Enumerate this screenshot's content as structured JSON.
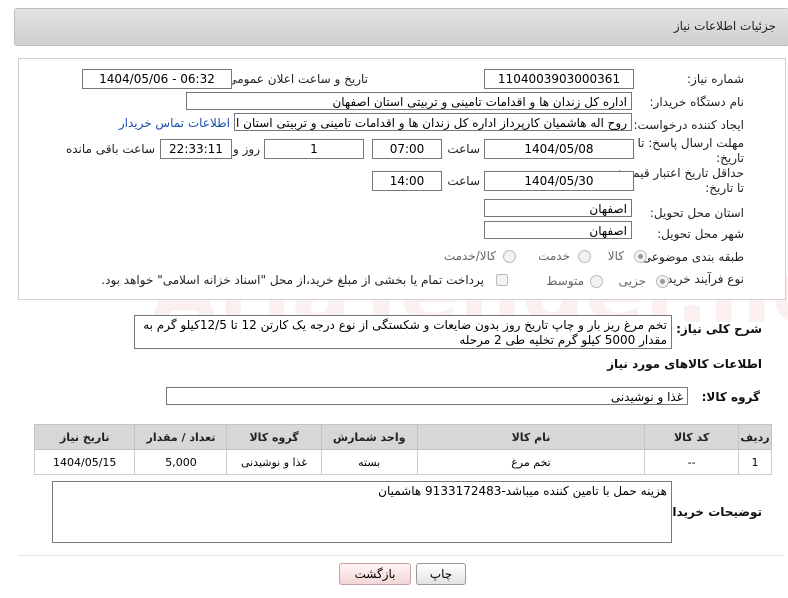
{
  "header": {
    "title": "جزئیات اطلاعات نیاز"
  },
  "form": {
    "need_number_label": "شماره نیاز:",
    "need_number": "1104003903000361",
    "announce_label": "تاریخ و ساعت اعلان عمومی:",
    "announce_value": "1404/05/06 - 06:32",
    "buyer_org_label": "نام دستگاه خریدار:",
    "buyer_org": "اداره کل زندان ها و اقدامات تامینی و تربیتی استان اصفهان",
    "creator_label": "ایجاد کننده درخواست:",
    "creator": "روح اله هاشمیان کارپرداز اداره کل زندان ها و اقدامات تامینی و تربیتی استان اصفهان",
    "contact_link": "اطلاعات تماس خریدار",
    "deadline_label": "مهلت ارسال پاسخ: تا تاریخ:",
    "deadline_date": "1404/05/08",
    "time_label": "ساعت",
    "deadline_time": "07:00",
    "days_value": "1",
    "days_label": "روز و",
    "remaining_time": "22:33:11",
    "remaining_label": "ساعت باقی مانده",
    "price_validity_label": "حداقل تاریخ اعتبار قیمت: تا تاریخ:",
    "price_date": "1404/05/30",
    "price_time": "14:00",
    "province_label": "استان محل تحویل:",
    "province": "اصفهان",
    "city_label": "شهر محل تحویل:",
    "city": "اصفهان",
    "category_label": "طبقه بندی موضوعی:",
    "category_options": [
      "کالا",
      "خدمت",
      "کالا/خدمت"
    ],
    "process_label": "نوع فرآیند خرید :",
    "process_options": [
      "جزیی",
      "متوسط"
    ],
    "payment_note": "پرداخت تمام یا بخشی از مبلغ خرید،از محل \"اسناد خزانه اسلامی\" خواهد بود."
  },
  "description": {
    "label": "شرح کلی نیاز:",
    "text": "تخم مرغ ریز بار و چاپ تاریخ روز بدون ضایعات و شکستگی از نوع درجه یک کارتن 12 تا 12/5کیلو گرم به مقدار 5000 کیلو گرم تخلیه طی 2 مرحله"
  },
  "goods_section": {
    "title": "اطلاعات کالاهای مورد نیاز",
    "group_label": "گروه کالا:",
    "group_value": "غذا و نوشیدنی"
  },
  "table": {
    "headers": [
      "ردیف",
      "کد کالا",
      "نام کالا",
      "واحد شمارش",
      "گروه کالا",
      "تعداد / مقدار",
      "تاریخ نیاز"
    ],
    "rows": [
      [
        "1",
        "--",
        "تخم مرغ",
        "بسته",
        "غذا و نوشیدنی",
        "5,000",
        "1404/05/15"
      ]
    ]
  },
  "buyer_notes": {
    "label": "توضیحات خریدار:",
    "text": "هزینه حمل با تامین کننده میباشد-9133172483 هاشمیان"
  },
  "buttons": {
    "print": "چاپ",
    "back": "بازگشت"
  },
  "watermark": "AriaTender.neT"
}
